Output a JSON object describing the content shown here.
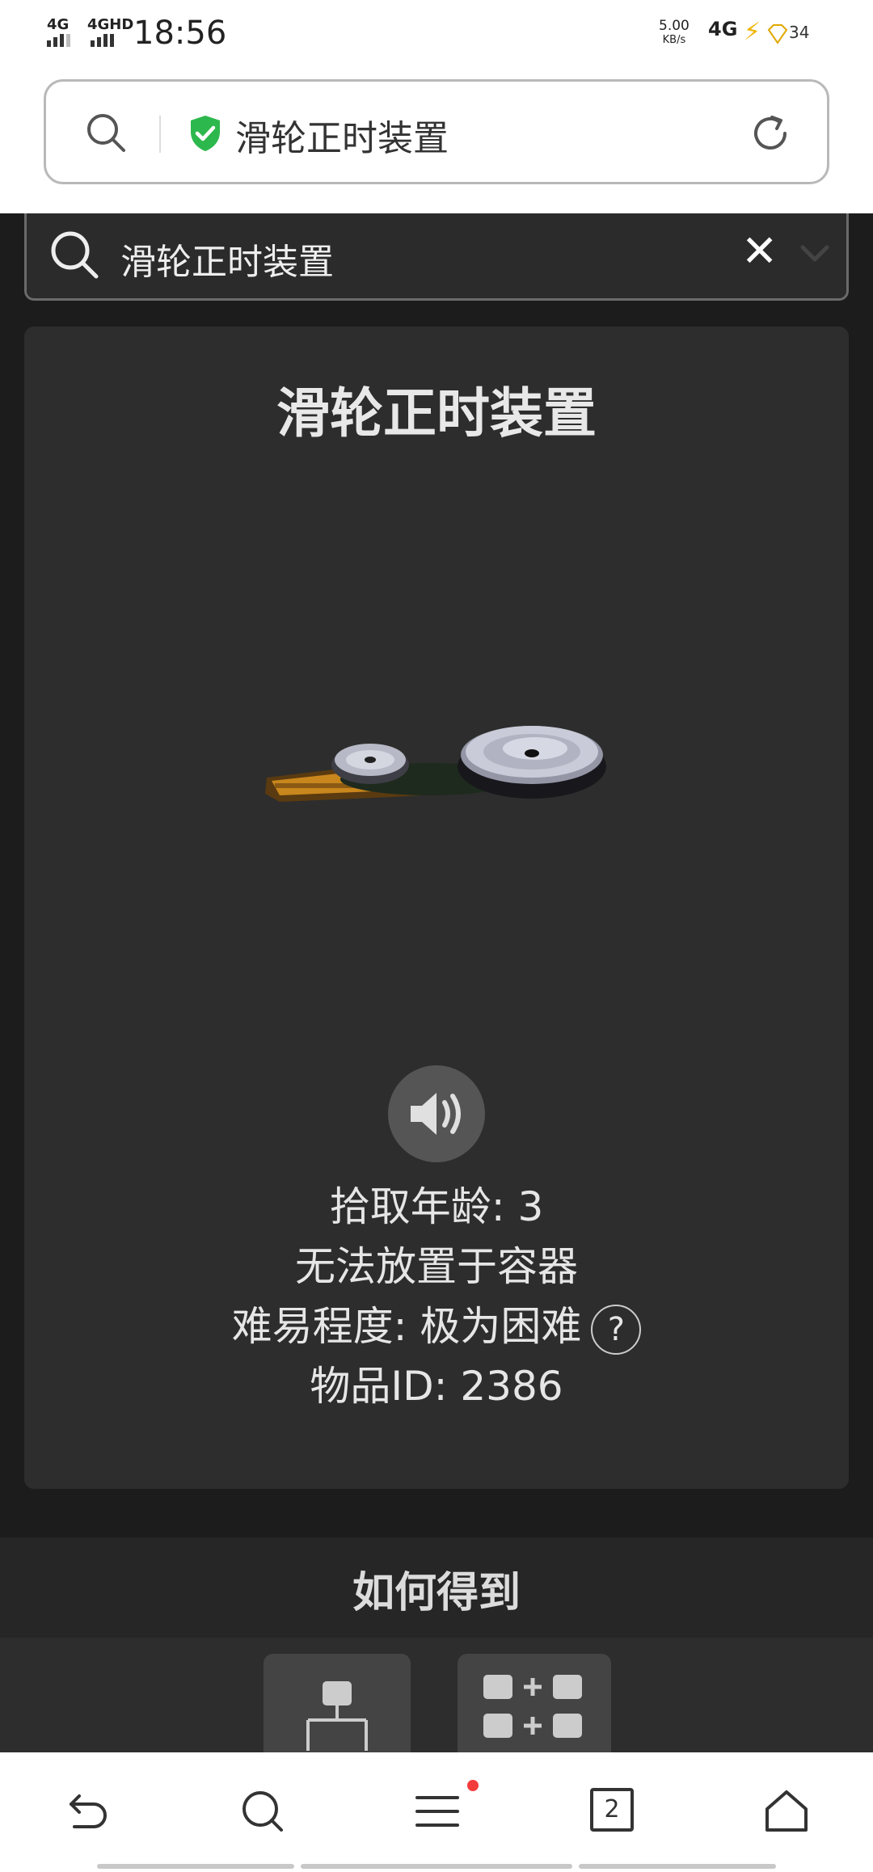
{
  "status_bar": {
    "signal1": "4G",
    "signal2": "4GHD",
    "time": "18:56",
    "speed_value": "5.00",
    "speed_unit": "KB/s",
    "net": "4G",
    "battery": "34"
  },
  "browser": {
    "url_text": "滑轮正时装置",
    "secure_color": "#2db84d"
  },
  "search": {
    "value": "滑轮正时装置",
    "clear_glyph": "✕"
  },
  "item": {
    "title": "滑轮正时装置",
    "pickup_age": "拾取年龄: 3",
    "container": "无法放置于容器",
    "difficulty": "难易程度: 极为困难",
    "help_glyph": "?",
    "item_id": "物品ID: 2386"
  },
  "how_to_get": {
    "title": "如何得到"
  },
  "nav": {
    "tab_count": "2",
    "badge_color": "#f23c3c"
  }
}
